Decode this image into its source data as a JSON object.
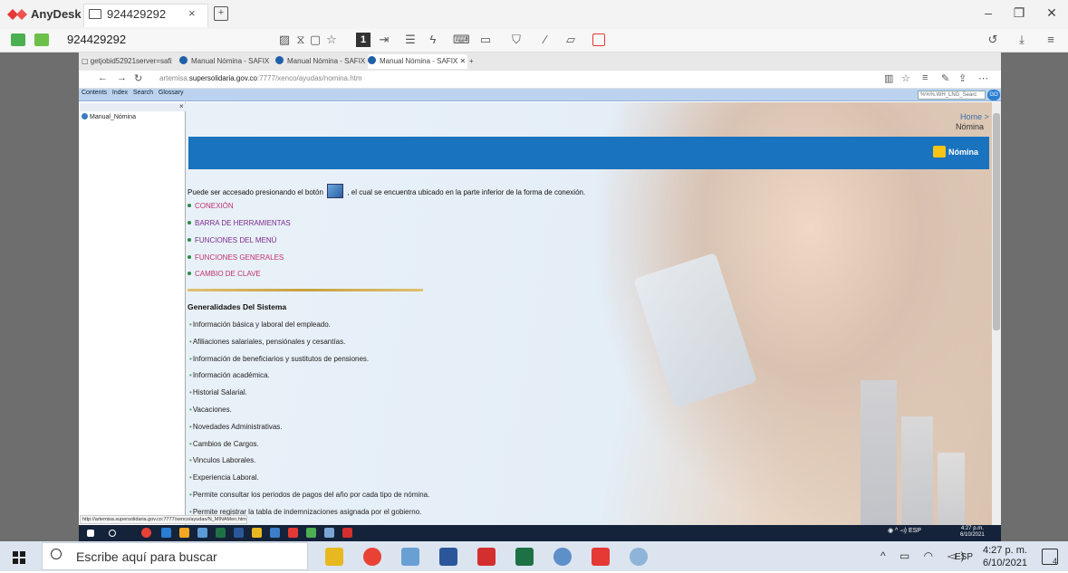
{
  "anydesk": {
    "app_name": "AnyDesk",
    "tab_label": "924429292",
    "address": "924429292",
    "toolbar_number": "1"
  },
  "browser": {
    "tabs": [
      {
        "label": "getjobid52921server=safix"
      },
      {
        "label": "Manual Nómina - SAFIX"
      },
      {
        "label": "Manual Nómina - SAFIX"
      },
      {
        "label": "Manual Nómina - SAFIX"
      }
    ],
    "url_prefix": "artemisa.",
    "url_host": "supersolidaria.gov.co",
    "url_path": ":7777/xenco/ayudas/nomina.htm"
  },
  "help_toolbar": {
    "contents": "Contents",
    "index": "Index",
    "search": "Search",
    "glossary": "Glossary",
    "search_value": "%%%.WH_LNG_Searc",
    "go": "GO"
  },
  "toc": {
    "item": "Manual_Nómina"
  },
  "content": {
    "crumb_home": "Home >",
    "crumb_page": "Nómina",
    "band_title": "Nómina",
    "intro_before": "Puede ser accesado presionando el botón",
    "intro_after": ", el cual se encuentra ubicado en la parte inferior de la forma de conexión.",
    "links": [
      {
        "label": "CONEXIÓN",
        "color": "#c03070"
      },
      {
        "label": "BARRA DE HERRAMIENTAS",
        "color": "#7a2a8a"
      },
      {
        "label": "FUNCIONES DEL MENÚ",
        "color": "#7a2a8a"
      },
      {
        "label": "FUNCIONES GENERALES",
        "color": "#c03070"
      },
      {
        "label": "CAMBIO DE CLAVE",
        "color": "#c03070"
      }
    ],
    "section_title": "Generalidades Del Sistema",
    "items": [
      "Información básica y laboral del empleado.",
      "Afiliaciones salariales, pensiónales y cesantías.",
      "Información de beneficiarios y sustitutos de pensiones.",
      "Información académica.",
      "Historial Salarial.",
      "Vacaciones.",
      "Novedades Administrativas.",
      "Cambios de Cargos.",
      "Vinculos Laborales.",
      "Experiencia Laboral.",
      "Permite consultar los periodos de pagos del año por cada tipo de nómina.",
      "Permite registrar la tabla de indemnizaciones asignada por el gobierno."
    ]
  },
  "status_url": "http://artemisa.supersolidaria.gov.co:7777/xenco/ayudas/N_MINAMen.htm",
  "remote_taskbar": {
    "lang": "ESP",
    "time": "4:27 p.m.",
    "date": "6/10/2021"
  },
  "taskbar": {
    "search_placeholder": "Escribe aquí para buscar",
    "lang": "ESP",
    "time": "4:27 p. m.",
    "date": "6/10/2021",
    "notifications": "4"
  }
}
